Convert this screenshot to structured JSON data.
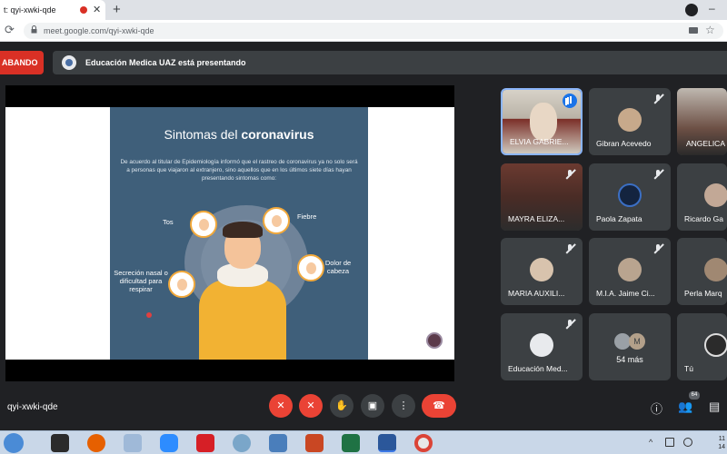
{
  "browser": {
    "tab_title": "t: qyi-xwki-qde",
    "tab_close": "✕",
    "new_tab": "+",
    "reload": "⟳",
    "url": "meet.google.com/qyi-xwki-qde",
    "star": "☆"
  },
  "meet": {
    "recording_label": "ABANDO",
    "presenting_text": "Educación Medica UAZ está presentando",
    "meeting_code": "qyi-xwki-qde"
  },
  "slide": {
    "title_plain": "Sintomas del ",
    "title_bold": "coronavirus",
    "body": "De acuerdo al titular de Epidemiología informó que el rastreo de coronavirus ya no solo será a personas que viajaron al extranjero, sino aquellos que en los últimos siete días hayan presentando sintomas como:",
    "symptom_tos": "Tos",
    "symptom_fiebre": "Fiebre",
    "symptom_dolor": "Dolor de cabeza",
    "symptom_secrecion": "Secreción nasal o dificultad para respirar"
  },
  "participants": [
    {
      "name": "ELVIA GABRIE..."
    },
    {
      "name": "Gibran Acevedo"
    },
    {
      "name": "ANGELICA"
    },
    {
      "name": "MAYRA ELIZA..."
    },
    {
      "name": "Paola Zapata"
    },
    {
      "name": "Ricardo Ga"
    },
    {
      "name": "MARIA AUXILI..."
    },
    {
      "name": "M.I.A. Jaime Ci..."
    },
    {
      "name": "Perla Marq"
    },
    {
      "name": "Educación Med..."
    },
    {
      "name": "54 más"
    },
    {
      "name": "Tú"
    }
  ],
  "more_avatar_letter": "M",
  "controls": {
    "mic": "✕",
    "camera": "✕",
    "raise_hand": "✋",
    "present": "▣",
    "more": "⋮",
    "end_call": "☎",
    "info": "ⓘ",
    "people_count": "64",
    "people": "👥",
    "chat": "▤"
  },
  "taskbar": {
    "time_line1": "11",
    "time_line2": "14",
    "tray_up": "^"
  },
  "colors": {
    "meet_bg": "#202124",
    "tile_bg": "#3c4043",
    "danger": "#ea4335",
    "slide_bg": "#3f5f7a",
    "accent_blue": "#1a73e8"
  }
}
